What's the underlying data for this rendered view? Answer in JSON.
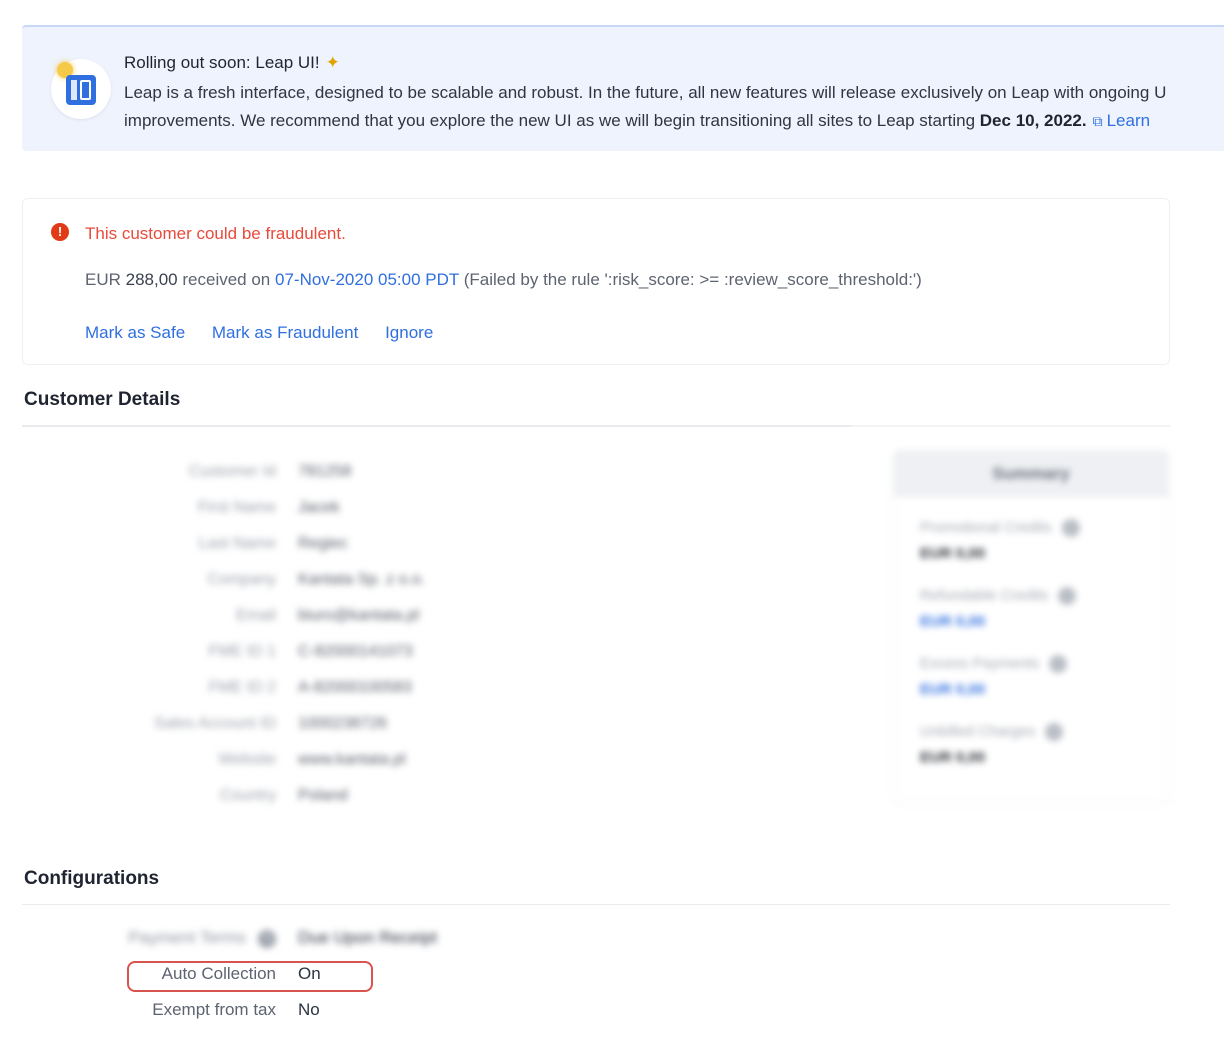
{
  "banner": {
    "title": "Rolling out soon: Leap UI!",
    "text_line1": "Leap is a fresh interface, designed to be scalable and robust. In the future, all new features will release exclusively on Leap with ongoing U",
    "text_line2_prefix": "improvements. We recommend that you explore the new UI as we will begin transitioning all sites to Leap starting",
    "text_line2_date": "Dec 10, 2022.",
    "learn_link": "Learn",
    "icon": "leap-ui-icon",
    "link_icon": "external-link-icon"
  },
  "alert": {
    "icon": "alert-icon",
    "title": "This customer could be fraudulent.",
    "currency": "EUR",
    "amount": "288,00",
    "received_on": "received on",
    "datetime": "07-Nov-2020 05:00 PDT",
    "rule_text": "(Failed by the rule ':risk_score: >= :review_score_threshold:')",
    "actions": {
      "mark_safe": "Mark as Safe",
      "mark_fraud": "Mark as Fraudulent",
      "ignore": "Ignore"
    }
  },
  "customer_details": {
    "heading": "Customer Details",
    "rows": [
      {
        "label": "Customer Id",
        "value": "781258"
      },
      {
        "label": "First Name",
        "value": "Jacek"
      },
      {
        "label": "Last Name",
        "value": "Regiec"
      },
      {
        "label": "Company",
        "value": "Kantata Sp. z o.o."
      },
      {
        "label": "Email",
        "value": "biuro@kantata.pl"
      },
      {
        "label": "FME ID 1",
        "value": "C-82000141073"
      },
      {
        "label": "FME ID 2",
        "value": "A-82000100583"
      },
      {
        "label": "Sales Account ID",
        "value": "1000238726"
      },
      {
        "label": "Website",
        "value": "www.kantata.pl"
      },
      {
        "label": "Country",
        "value": "Poland"
      }
    ]
  },
  "summary": {
    "heading": "Summary",
    "items": [
      {
        "label": "Promotional Credits",
        "value": "EUR 0,00",
        "color": "#2b2f36"
      },
      {
        "label": "Refundable Credits",
        "value": "EUR 0,00",
        "color": "#2f6fe0"
      },
      {
        "label": "Excess Payments",
        "value": "EUR 0,00",
        "color": "#2f6fe0"
      },
      {
        "label": "Unbilled Charges",
        "value": "EUR 0,00",
        "color": "#2b2f36"
      }
    ]
  },
  "configurations": {
    "heading": "Configurations",
    "payment_terms_label": "Payment Terms",
    "payment_terms_value": "Due Upon Receipt",
    "auto_collection_label": "Auto Collection",
    "auto_collection_value": "On",
    "exempt_label": "Exempt from tax",
    "exempt_value": "No"
  }
}
